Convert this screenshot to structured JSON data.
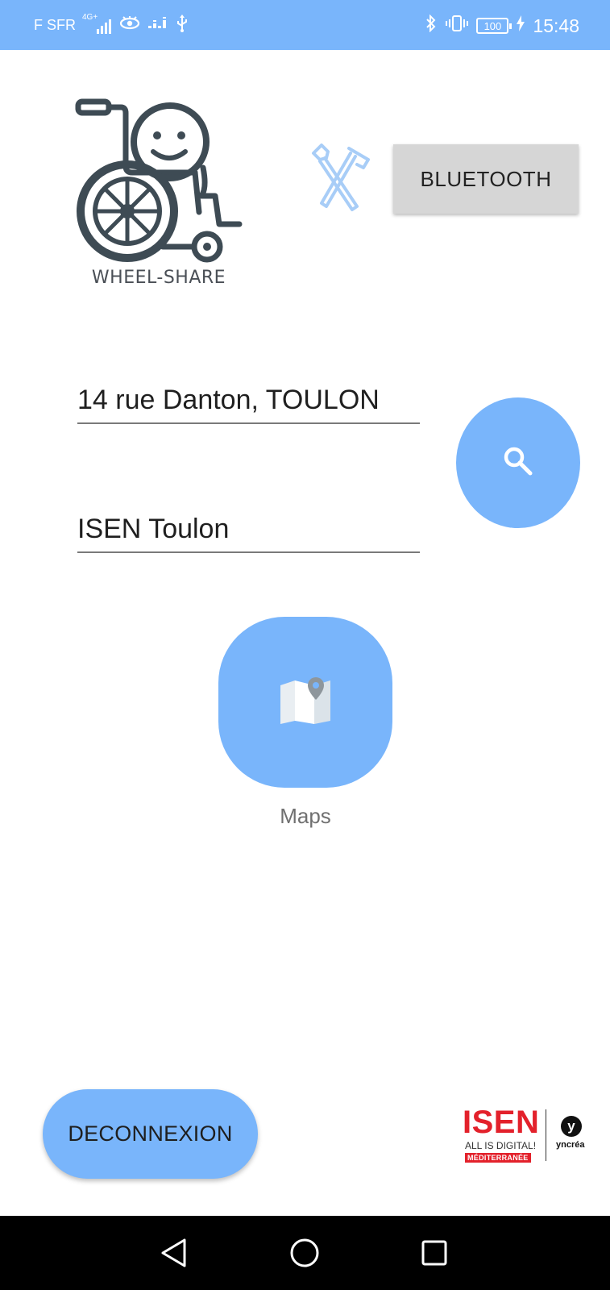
{
  "status_bar": {
    "carrier": "F SFR",
    "network": "4G+",
    "battery": "100",
    "time": "15:48",
    "icons": [
      "signal-icon",
      "eye-icon",
      "data-icon",
      "usb-icon",
      "bluetooth-icon",
      "vibrate-icon",
      "battery-icon",
      "charging-icon"
    ]
  },
  "logo": {
    "text": "WHEEL-SHARE",
    "icon": "wheelchair-smiley-icon"
  },
  "toolbar": {
    "tools_icon": "tools-icon",
    "bluetooth_label": "BLUETOOTH"
  },
  "route": {
    "from_value": "14 rue Danton, TOULON",
    "to_value": "ISEN Toulon",
    "search_icon": "search-icon"
  },
  "maps": {
    "label": "Maps",
    "icon": "map-icon"
  },
  "footer": {
    "logout_label": "DECONNEXION",
    "isen_word": "ISEN",
    "isen_tagline": "ALL IS DIGITAL!",
    "isen_region": "MÉDITERRANÉE",
    "partner_initial": "y",
    "partner_name": "yncréa"
  },
  "nav": {
    "icons": [
      "back-icon",
      "home-icon",
      "recents-icon"
    ]
  },
  "colors": {
    "accent": "#79b5fb",
    "button_grey": "#d6d6d6",
    "isen_red": "#e3212b"
  }
}
